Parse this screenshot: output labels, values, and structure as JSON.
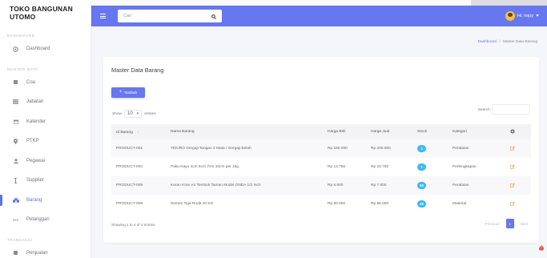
{
  "brand": "TOKO BANGUNAN UTOMO",
  "sidebar": {
    "sections": [
      {
        "title": "DASHBOARD",
        "items": [
          {
            "label": "Dashboard",
            "icon": "dashboard-icon"
          }
        ]
      },
      {
        "title": "MASTER DATA",
        "items": [
          {
            "label": "Coa",
            "icon": "square-icon"
          },
          {
            "label": "Jabatan",
            "icon": "grid-icon"
          },
          {
            "label": "Kalender",
            "icon": "calendar-icon"
          },
          {
            "label": "PTKP",
            "icon": "map-pin-icon"
          },
          {
            "label": "Pegawai",
            "icon": "user-icon"
          },
          {
            "label": "Supplier",
            "icon": "truck-icon"
          },
          {
            "label": "Barang",
            "icon": "boxes-icon",
            "active": true
          },
          {
            "label": "Pelanggan",
            "icon": "users-icon"
          }
        ]
      },
      {
        "title": "TRANSAKSI",
        "items": [
          {
            "label": "Penjualan",
            "icon": "square-icon"
          }
        ]
      }
    ]
  },
  "topbar": {
    "search_placeholder": "Cari",
    "user_greeting": "Hi, nopy"
  },
  "breadcrumb": {
    "link": "Dashboard",
    "separator": "/",
    "current": "Master Data Barang"
  },
  "card": {
    "title": "Master Data Barang",
    "add_button": "Tambah",
    "show_label": "Show",
    "entries_value": "10",
    "entries_label": "entries",
    "search_label": "Search:"
  },
  "table": {
    "headers": [
      "Id Barang",
      "Nama Barang",
      "Harga Beli",
      "Harga Jual",
      "Stock",
      "Kategori",
      ""
    ],
    "rows": [
      [
        "PRODUCT-001",
        "TEKIRO Gergaji Tangan 2 Mata / Gergaji Belah",
        "Rp 150.000",
        "Rp 200.000",
        "3",
        "Peralatan"
      ],
      [
        "PRODUCT-004",
        "Paku Kayu 4cm 5cm 7cm 10cm per 1kg",
        "Rp 14.750",
        "Rp 15.750",
        "1",
        "Perlengkapan"
      ],
      [
        "PRODUCT-008",
        "Keran Kran Air Tembok Taman Model ONDA 1/2 Inch",
        "Rp 6.500",
        "Rp 7.000",
        "50",
        "Peralatan"
      ],
      [
        "PRODUCT-009",
        "Semen Tiga Roda 40 KG",
        "Rp 50.000",
        "Rp 55.000",
        "49",
        "Material"
      ]
    ]
  },
  "footer": {
    "showing": "Showing 1 to 4 of 4 entries",
    "previous": "Previous",
    "page": "1",
    "next": "Next"
  },
  "colors": {
    "primary": "#6777ef",
    "badge": "#3abaf4",
    "edit": "#f0a63c",
    "flame": "#fc544b"
  }
}
